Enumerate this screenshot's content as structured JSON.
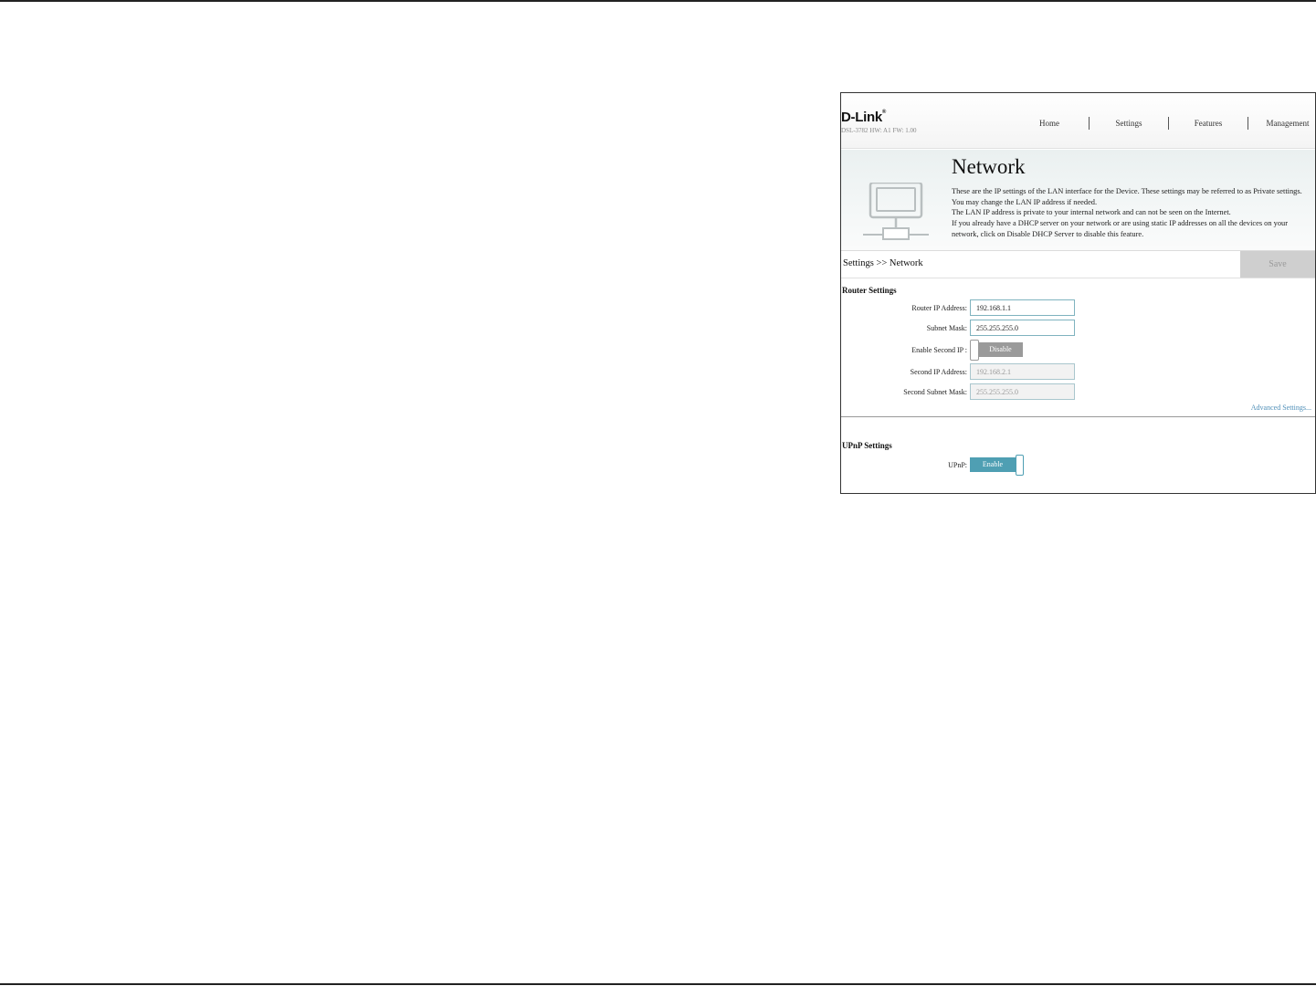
{
  "header": {
    "logo": "D-Link",
    "logo_mark": "®",
    "hw_info": "DSL-3782  HW: A1  FW: 1.00",
    "nav": [
      "Home",
      "Settings",
      "Features",
      "Management"
    ]
  },
  "banner": {
    "title": "Network",
    "description": [
      "These are the IP settings of the LAN interface for the Device. These settings may be referred to as Private settings. You may change the LAN IP address if needed.",
      "The LAN IP address is private to your internal network and can not be seen on the Internet.",
      "If you already have a DHCP server on your network or are using static IP addresses on all the devices on your network, click on Disable DHCP Server to disable this feature."
    ]
  },
  "breadcrumb": "Settings >> Network",
  "save_label": "Save",
  "router_settings": {
    "title": "Router Settings",
    "router_ip_label": "Router IP Address:",
    "router_ip_value": "192.168.1.1",
    "subnet_mask_label": "Subnet Mask:",
    "subnet_mask_value": "255.255.255.0",
    "enable_second_ip_label": "Enable Second IP :",
    "enable_second_ip_state": "Disable",
    "second_ip_label": "Second IP Address:",
    "second_ip_value": "192.168.2.1",
    "second_mask_label": "Second Subnet Mask:",
    "second_mask_value": "255.255.255.0",
    "advanced_link": "Advanced Settings..."
  },
  "upnp_settings": {
    "title": "UPnP Settings",
    "upnp_label": "UPnP:",
    "upnp_state": "Enable"
  },
  "colors": {
    "accent": "#4f9fb3",
    "toggle_off": "#9a9a9a",
    "save_disabled": "#cfcfcf",
    "link": "#4f8fb8"
  }
}
